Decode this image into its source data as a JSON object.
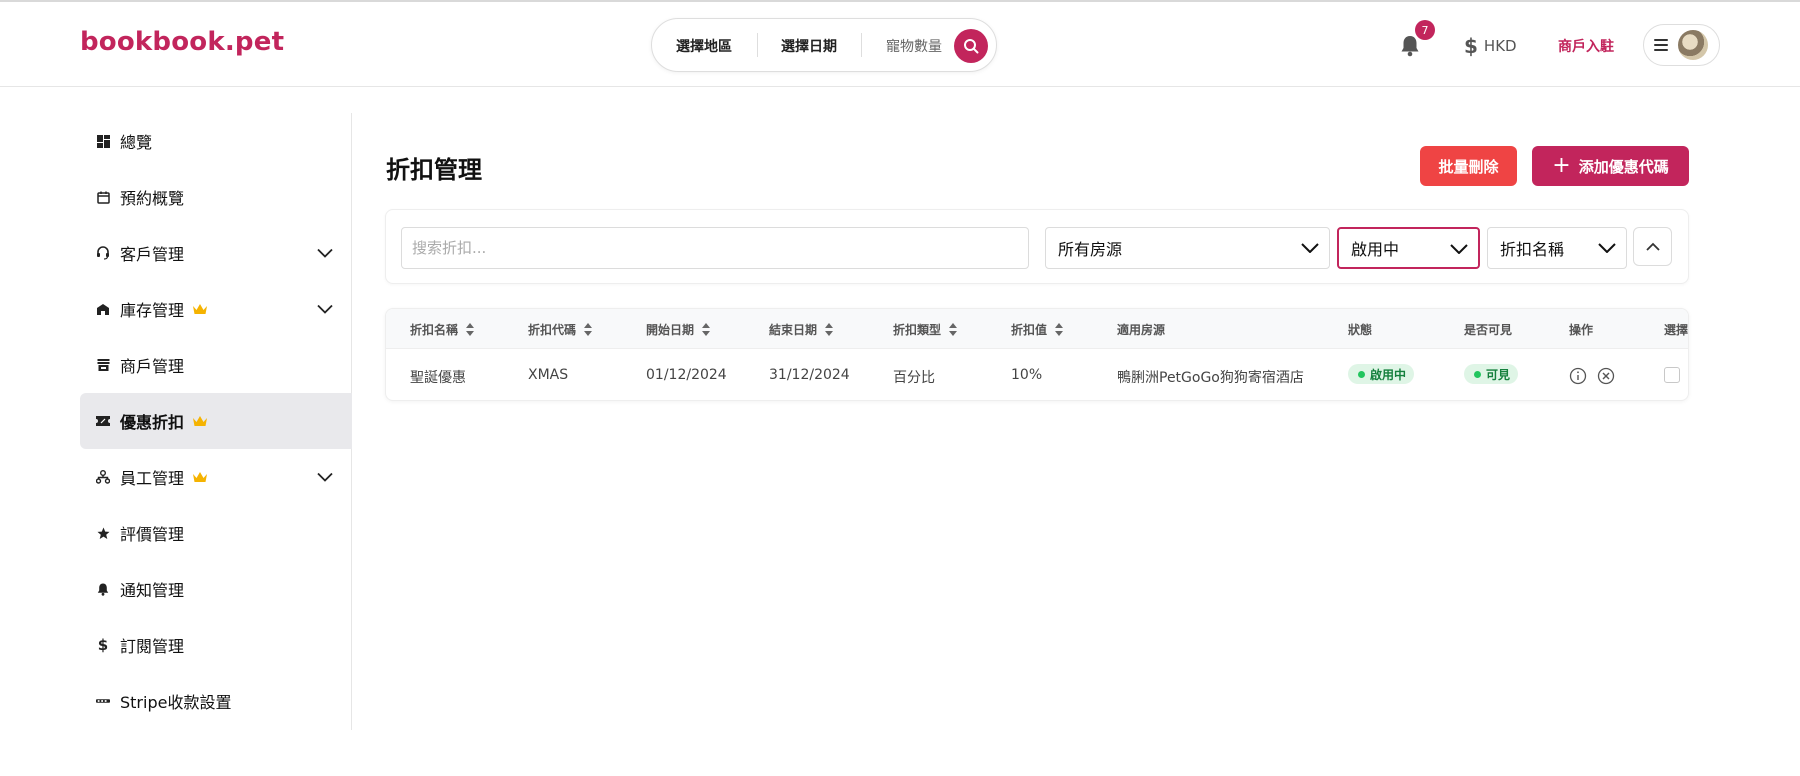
{
  "header": {
    "logo": "bookbook.pet",
    "search": {
      "region": "選擇地區",
      "date": "選擇日期",
      "pets": "寵物數量"
    },
    "notifications_count": "7",
    "currency": "HKD",
    "merchant_link": "商戶入駐"
  },
  "sidebar": {
    "items": [
      {
        "label": "總覽",
        "icon": "dashboard-icon"
      },
      {
        "label": "預約概覽",
        "icon": "calendar-icon"
      },
      {
        "label": "客戶管理",
        "icon": "headset-icon",
        "expandable": true
      },
      {
        "label": "庫存管理",
        "icon": "store-icon",
        "premium": true,
        "expandable": true
      },
      {
        "label": "商戶管理",
        "icon": "shop-icon"
      },
      {
        "label": "優惠折扣",
        "icon": "ticket-icon",
        "premium": true,
        "active": true
      },
      {
        "label": "員工管理",
        "icon": "org-chart-icon",
        "premium": true,
        "expandable": true
      },
      {
        "label": "評價管理",
        "icon": "star-icon"
      },
      {
        "label": "通知管理",
        "icon": "bell-icon"
      },
      {
        "label": "訂閱管理",
        "icon": "dollar-icon"
      },
      {
        "label": "Stripe收款設置",
        "icon": "stripe-icon"
      }
    ]
  },
  "main": {
    "title": "折扣管理",
    "bulk_delete_label": "批量刪除",
    "add_coupon_label": "添加優惠代碼",
    "filters": {
      "search_placeholder": "搜索折扣...",
      "property": "所有房源",
      "status": "啟用中",
      "sort": "折扣名稱"
    },
    "table": {
      "columns": [
        "折扣名稱",
        "折扣代碼",
        "開始日期",
        "結束日期",
        "折扣類型",
        "折扣值",
        "適用房源",
        "狀態",
        "是否可見",
        "操作",
        "選擇"
      ],
      "rows": [
        {
          "name": "聖誕優惠",
          "code": "XMAS",
          "start": "01/12/2024",
          "end": "31/12/2024",
          "type": "百分比",
          "value": "10%",
          "property": "鴨脷洲PetGoGo狗狗寄宿酒店",
          "status": "啟用中",
          "visible": "可見"
        }
      ]
    }
  },
  "colors": {
    "brand": "#c2255c",
    "danger": "#ef4444",
    "success": "#22c55e",
    "crown": "#f5b301"
  }
}
